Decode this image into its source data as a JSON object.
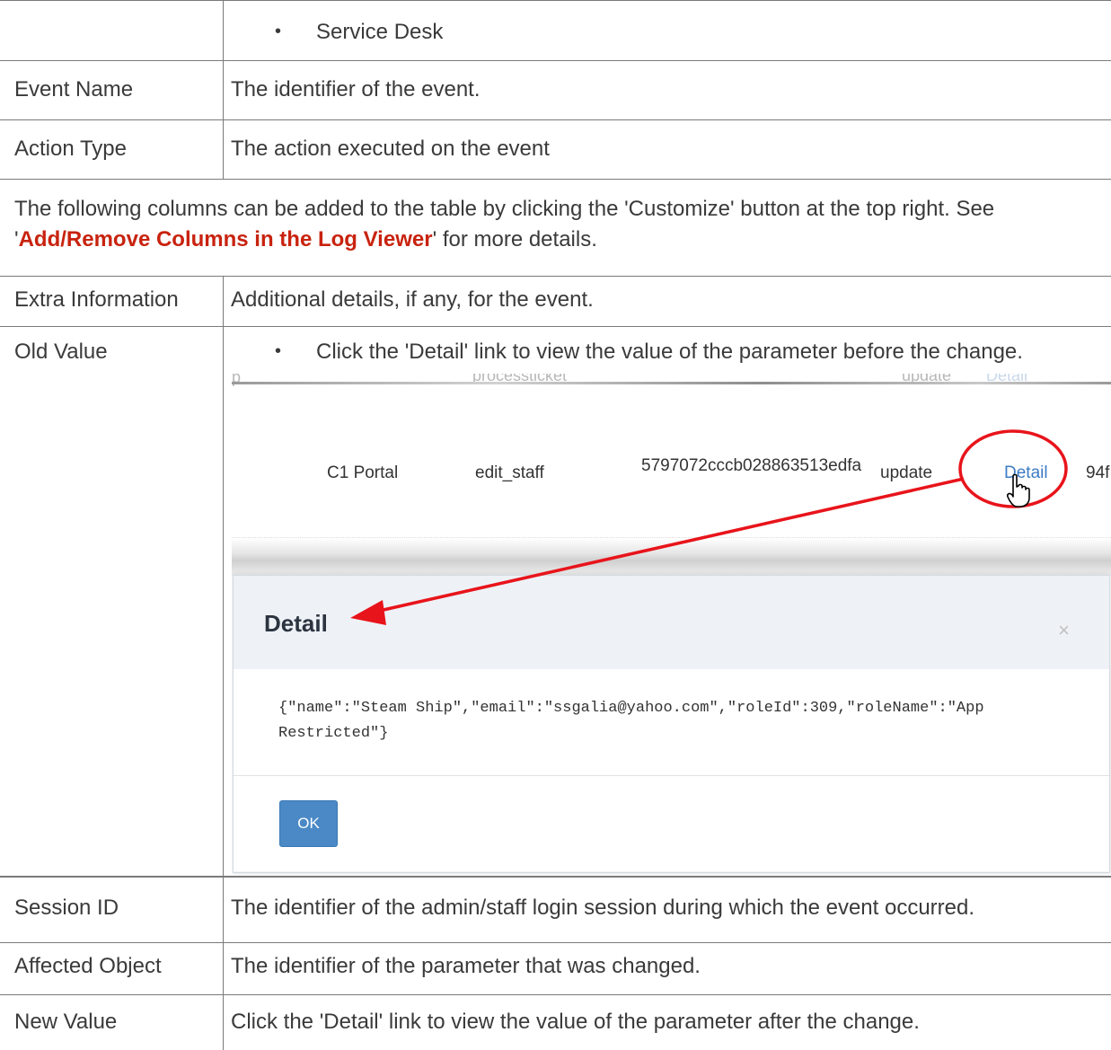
{
  "rows": [
    {
      "label": "",
      "description": "Service Desk",
      "bulleted": true
    },
    {
      "label": "Event Name",
      "description": "The identifier of the event."
    },
    {
      "label": "Action Type",
      "description": "The action executed on the event"
    }
  ],
  "note": {
    "before": "The following columns can be added to the table by clicking the 'Customize' button at the top right. See",
    "quote_open": "'",
    "link": "Add/Remove Columns in the Log Viewer",
    "after": "' for more details."
  },
  "extra_row": {
    "label": "Extra Information",
    "description": "Additional details, if any, for the event."
  },
  "old_value_row": {
    "label": "Old Value",
    "description": "Click the 'Detail' link to view the value of the parameter before the change."
  },
  "screenshot": {
    "faint_top": [
      "p",
      "processticket",
      "update",
      "Detail"
    ],
    "row": {
      "portal": "C1 Portal",
      "event": "edit_staff",
      "session": "5797072cccb028863513edfa",
      "action": "update",
      "detail": "Detail",
      "affected": "94f"
    },
    "modal": {
      "title": "Detail",
      "close": "×",
      "code_line1": "{\"name\":\"Steam Ship\",\"email\":\"ssgalia@yahoo.com\",\"roleId\":309,\"roleName\":\"App",
      "code_line2": "Restricted\"}",
      "ok": "OK"
    },
    "annotation_color": "#e8141b"
  },
  "bottom_rows": [
    {
      "label": "Session ID",
      "description": "The identifier of the admin/staff login session during which the event occurred."
    },
    {
      "label": "Affected Object",
      "description": "The identifier of the parameter that was changed."
    },
    {
      "label": "New Value",
      "description": "Click the 'Detail' link to view the value of the parameter after the change."
    }
  ],
  "colors": {
    "link": "#c8230f",
    "border": "#7a7a7a",
    "text": "#3a3a3a",
    "button": "#4a89c6"
  }
}
